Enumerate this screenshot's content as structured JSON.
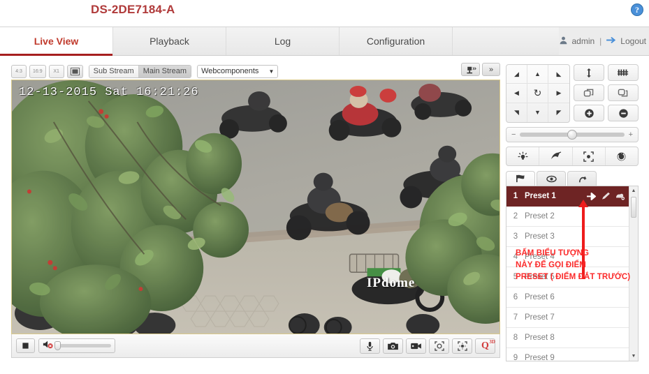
{
  "header": {
    "model": "DS-2DE7184-A",
    "help_icon": "help-circle-icon"
  },
  "nav": {
    "tabs": [
      {
        "label": "Live View",
        "active": true
      },
      {
        "label": "Playback",
        "active": false
      },
      {
        "label": "Log",
        "active": false
      },
      {
        "label": "Configuration",
        "active": false
      }
    ],
    "user": {
      "user_icon": "user-icon",
      "name": "admin",
      "separator": "|",
      "logout_icon": "logout-icon",
      "logout_label": "Logout"
    }
  },
  "video_toolbar": {
    "aspect_4_3": "4:3",
    "aspect_16_9": "16:9",
    "aspect_x1": "X1",
    "fullscreen_icon": "fullscreen-icon",
    "streams": [
      {
        "label": "Sub Stream",
        "active": false
      },
      {
        "label": "Main Stream",
        "active": true
      }
    ],
    "plugin": {
      "value": "Webcomponents",
      "caret": "▼"
    },
    "ptz_icon": "ptz-lens-icon",
    "expand_label": "»"
  },
  "video": {
    "timestamp": "12-13-2015 Sat 16:21:26",
    "watermark": "IPdome"
  },
  "player_bar": {
    "stop_icon": "stop-icon",
    "volume_icon": "volume-muted-icon",
    "right_buttons": [
      {
        "icon": "microphone-icon",
        "name": "audio-talk-button"
      },
      {
        "icon": "camera-icon",
        "name": "capture-button"
      },
      {
        "icon": "record-icon",
        "name": "record-button"
      },
      {
        "icon": "regional-exposure-icon",
        "name": "regional-exposure-button"
      },
      {
        "icon": "regional-focus-icon",
        "name": "regional-focus-button"
      }
    ],
    "zoom3d": {
      "letter": "Q",
      "sup": "3D"
    }
  },
  "ptz": {
    "dpad": [
      {
        "icon": "arrow-up-left-icon",
        "glyph": "◢"
      },
      {
        "icon": "arrow-up-icon",
        "glyph": "▲"
      },
      {
        "icon": "arrow-up-right-icon",
        "glyph": "◣"
      },
      {
        "icon": "arrow-left-icon",
        "glyph": "◀"
      },
      {
        "icon": "auto-scan-icon",
        "glyph": "↻"
      },
      {
        "icon": "arrow-right-icon",
        "glyph": "▶"
      },
      {
        "icon": "arrow-down-left-icon",
        "glyph": "◥"
      },
      {
        "icon": "arrow-down-icon",
        "glyph": "▼"
      },
      {
        "icon": "arrow-down-right-icon",
        "glyph": "◤"
      }
    ],
    "side_buttons": [
      {
        "name": "zoom-in-button",
        "icon": "zoom-in-icon"
      },
      {
        "name": "zoom-out-button",
        "icon": "zoom-out-icon"
      },
      {
        "name": "focus-near-button",
        "icon": "focus-near-icon"
      },
      {
        "name": "focus-far-button",
        "icon": "focus-far-icon"
      },
      {
        "name": "iris-open-button",
        "icon": "iris-open-icon"
      },
      {
        "name": "iris-close-button",
        "icon": "iris-close-icon"
      }
    ],
    "speed": {
      "minus": "−",
      "plus": "+",
      "value": 50
    },
    "aux_buttons": [
      {
        "name": "light-button",
        "icon": "light-bulb-icon"
      },
      {
        "name": "wiper-button",
        "icon": "wiper-icon"
      },
      {
        "name": "auxiliary-focus-button",
        "icon": "auxiliary-focus-icon"
      },
      {
        "name": "lens-initialization-button",
        "icon": "lens-init-icon"
      }
    ],
    "tabs": [
      {
        "name": "tab-preset",
        "icon": "flag-icon",
        "active": true
      },
      {
        "name": "tab-patrol",
        "icon": "patrol-icon",
        "active": false
      },
      {
        "name": "tab-pattern",
        "icon": "pattern-icon",
        "active": false
      }
    ],
    "presets": [
      {
        "num": "1",
        "name": "Preset 1",
        "selected": true
      },
      {
        "num": "2",
        "name": "Preset 2",
        "selected": false
      },
      {
        "num": "3",
        "name": "Preset 3",
        "selected": false
      },
      {
        "num": "4",
        "name": "Preset 4",
        "selected": false
      },
      {
        "num": "5",
        "name": "Preset 5",
        "selected": false
      },
      {
        "num": "6",
        "name": "Preset 6",
        "selected": false
      },
      {
        "num": "7",
        "name": "Preset 7",
        "selected": false
      },
      {
        "num": "8",
        "name": "Preset 8",
        "selected": false
      },
      {
        "num": "9",
        "name": "Preset 9",
        "selected": false
      }
    ],
    "preset_actions": [
      {
        "name": "call-preset-button",
        "icon": "call-arrow-icon"
      },
      {
        "name": "set-preset-button",
        "icon": "pencil-icon"
      },
      {
        "name": "delete-preset-button",
        "icon": "delete-icon"
      }
    ],
    "scrollbar": {
      "up": "▲",
      "down": "▼"
    }
  },
  "annotation": {
    "line1": "BẤM BIỂU TƯỢNG",
    "line2": "NÀY ĐỂ GỌI ĐIỂM",
    "line3": "PRESET ( ĐIỂM ĐẮT TRƯỚC)",
    "color": "#fb2a2a"
  },
  "colors": {
    "brand_red": "#b03a3a",
    "tab_active_text": "#c0392b",
    "tab_underline": "#a61f1f",
    "preset_selected_bg": "#6e2424",
    "annotation_red": "#fb2a2a",
    "help_blue": "#4a90d9"
  }
}
